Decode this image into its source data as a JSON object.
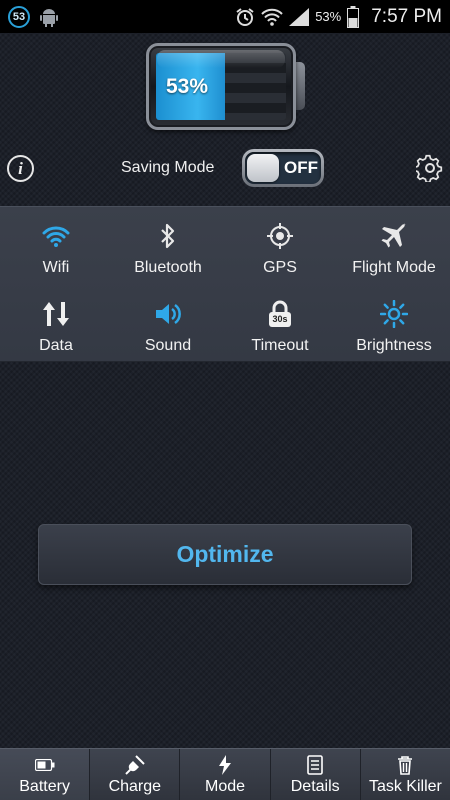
{
  "status_bar": {
    "notification_badge": "53",
    "battery_percent": "53%",
    "time": "7:57 PM",
    "icons": [
      "app-badge-icon",
      "android-icon",
      "alarm-icon",
      "wifi-icon",
      "signal-icon",
      "battery-icon"
    ]
  },
  "battery": {
    "level_text": "53%",
    "level_fraction": 0.53
  },
  "mode": {
    "label": "Saving Mode",
    "toggle_state": "OFF",
    "info_glyph": "i"
  },
  "quick_toggles": [
    {
      "label": "Wifi",
      "icon": "wifi-icon",
      "active": true
    },
    {
      "label": "Bluetooth",
      "icon": "bluetooth-icon",
      "active": false
    },
    {
      "label": "GPS",
      "icon": "gps-icon",
      "active": false
    },
    {
      "label": "Flight Mode",
      "icon": "airplane-icon",
      "active": false
    },
    {
      "label": "Data",
      "icon": "data-icon",
      "active": false
    },
    {
      "label": "Sound",
      "icon": "sound-icon",
      "active": true
    },
    {
      "label": "Timeout",
      "icon": "timeout-icon",
      "badge": "30s",
      "active": false
    },
    {
      "label": "Brightness",
      "icon": "brightness-icon",
      "active": true
    }
  ],
  "optimize_label": "Optimize",
  "bottom_nav": [
    {
      "label": "Battery",
      "icon": "battery-icon",
      "active": true
    },
    {
      "label": "Charge",
      "icon": "plug-icon",
      "active": false
    },
    {
      "label": "Mode",
      "icon": "bolt-icon",
      "active": false
    },
    {
      "label": "Details",
      "icon": "list-icon",
      "active": false
    },
    {
      "label": "Task Killer",
      "icon": "trash-icon",
      "active": false
    }
  ],
  "colors": {
    "accent": "#2fa8e8",
    "background": "#1c2029",
    "panel": "#383d48",
    "optimize_text": "#52b7ee"
  }
}
